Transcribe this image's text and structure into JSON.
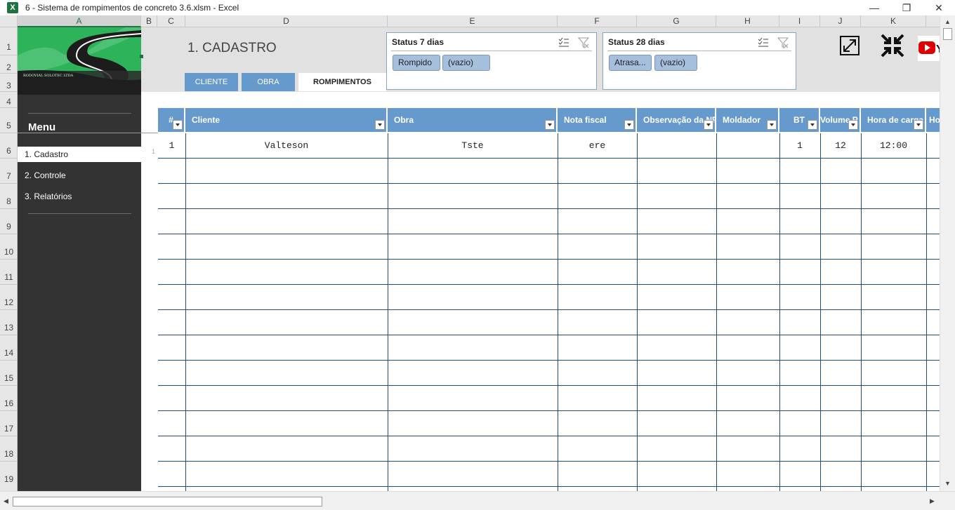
{
  "window": {
    "app_icon": "excel-icon",
    "title": "6 - Sistema de rompimentos de concreto 3.6.xlsm - Excel",
    "minimize": "—",
    "restore": "❐",
    "close": "✕"
  },
  "grid": {
    "columns": [
      "A",
      "B",
      "C",
      "D",
      "E",
      "F",
      "G",
      "H",
      "I",
      "J",
      "K"
    ],
    "selected_column": "A",
    "rows": [
      "1",
      "2",
      "3",
      "4",
      "5",
      "6",
      "7",
      "8",
      "9",
      "10",
      "11",
      "12",
      "13",
      "14",
      "15",
      "16",
      "17",
      "18",
      "19"
    ]
  },
  "logo": {
    "text": "RODOVIAL SOLOTEC LTDA"
  },
  "menu": {
    "title": "Menu",
    "items": [
      {
        "label": "1. Cadastro",
        "active": true
      },
      {
        "label": "2. Controle",
        "active": false
      },
      {
        "label": "3. Relatórios",
        "active": false
      }
    ]
  },
  "header": {
    "page_title": "1. CADASTRO",
    "tabs": [
      {
        "label": "CLIENTE",
        "active": false
      },
      {
        "label": "OBRA",
        "active": false
      },
      {
        "label": "ROMPIMENTOS",
        "active": true
      }
    ]
  },
  "slicers": [
    {
      "title": "Status 7 dias",
      "items": [
        "Rompido",
        "(vazio)"
      ]
    },
    {
      "title": "Status 28 dias",
      "items": [
        "Atrasa...",
        "(vazio)"
      ]
    }
  ],
  "table": {
    "columns": [
      "#",
      "Cliente",
      "Obra",
      "Nota fiscal",
      "Observação da NF",
      "Moldador",
      "BT",
      "Volume P",
      "Hora de carga",
      "Ho"
    ],
    "rows": [
      [
        "1",
        "Valteson",
        "Tste",
        "ere",
        "",
        "",
        "1",
        "12",
        "12:00",
        ""
      ]
    ],
    "row_index_hint": "1"
  },
  "colors": {
    "accent": "#6699cc",
    "sidebar": "#333333",
    "excel_green": "#217346",
    "grid_line": "#1f4e79"
  }
}
